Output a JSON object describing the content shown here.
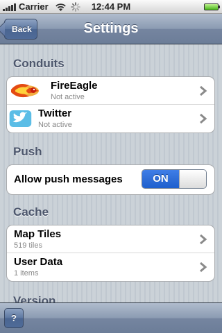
{
  "status_bar": {
    "carrier": "Carrier",
    "time": "12:44 PM",
    "icons": [
      "signal-bars-icon",
      "wifi-icon",
      "activity-spinner-icon",
      "battery-icon"
    ]
  },
  "nav_bar": {
    "back_label": "Back",
    "title": "Settings"
  },
  "sections": {
    "conduits": {
      "header": "Conduits",
      "rows": [
        {
          "title": "FireEagle",
          "subtitle": "Not active",
          "icon": "fireeagle-logo-icon"
        },
        {
          "title": "Twitter",
          "subtitle": "Not active",
          "icon": "twitter-bird-icon"
        }
      ]
    },
    "push": {
      "header": "Push",
      "label": "Allow push messages",
      "toggle_value": "ON"
    },
    "cache": {
      "header": "Cache",
      "rows": [
        {
          "title": "Map Tiles",
          "subtitle": "519 tiles"
        },
        {
          "title": "User Data",
          "subtitle": "1 items"
        }
      ]
    },
    "version": {
      "header": "Version"
    }
  },
  "toolbar": {
    "help_label": "?"
  },
  "colors": {
    "toggle_on": "#2f6ed7",
    "nav_bar": "#8b9bb2",
    "section_header": "#4c566c"
  }
}
